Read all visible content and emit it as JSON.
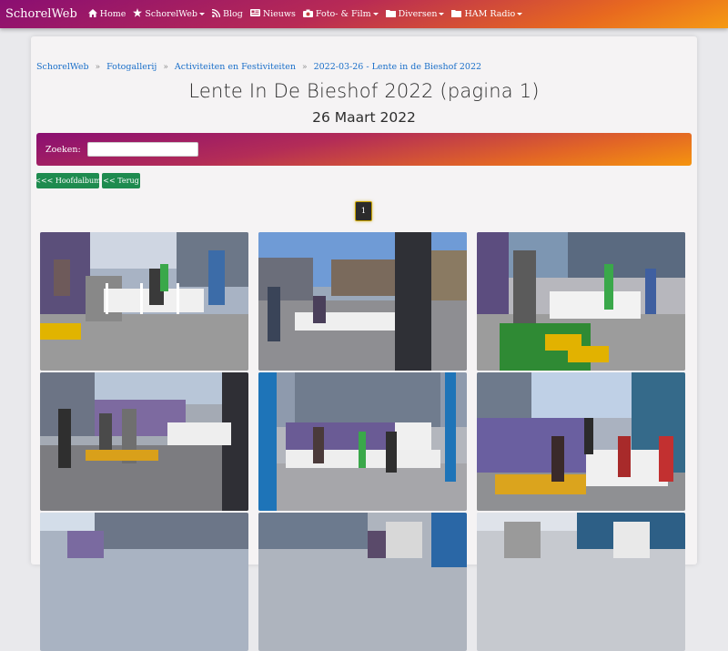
{
  "nav": {
    "brand": "SchorelWeb",
    "items": [
      {
        "label": "Home",
        "icon": "home-icon"
      },
      {
        "label": "SchorelWeb",
        "icon": "star-icon"
      },
      {
        "label": "Blog",
        "icon": "rss-icon"
      },
      {
        "label": "Nieuws",
        "icon": "newspaper-icon"
      },
      {
        "label": "Foto- & Film",
        "icon": "camera-icon"
      },
      {
        "label": "Diversen",
        "icon": "folder-icon"
      },
      {
        "label": "HAM Radio",
        "icon": "folder-icon"
      }
    ]
  },
  "breadcrumb": [
    "SchorelWeb",
    "Fotogallerij",
    "Activiteiten en Festiviteiten",
    "2022-03-26 - Lente in de Bieshof 2022"
  ],
  "page": {
    "title": "Lente In De Bieshof 2022 (pagina 1)",
    "date": "26 Maart 2022"
  },
  "search": {
    "label": "Zoeken:",
    "value": ""
  },
  "buttons": {
    "main_album": "<<< Hoofdalbum",
    "back": "<< Terug"
  },
  "pagination": {
    "current": "1"
  },
  "colors": {
    "gradient_start": "#8a0e72",
    "gradient_end": "#f59a14",
    "button_green": "#1e8b4f",
    "link_blue": "#1a6fc9"
  }
}
